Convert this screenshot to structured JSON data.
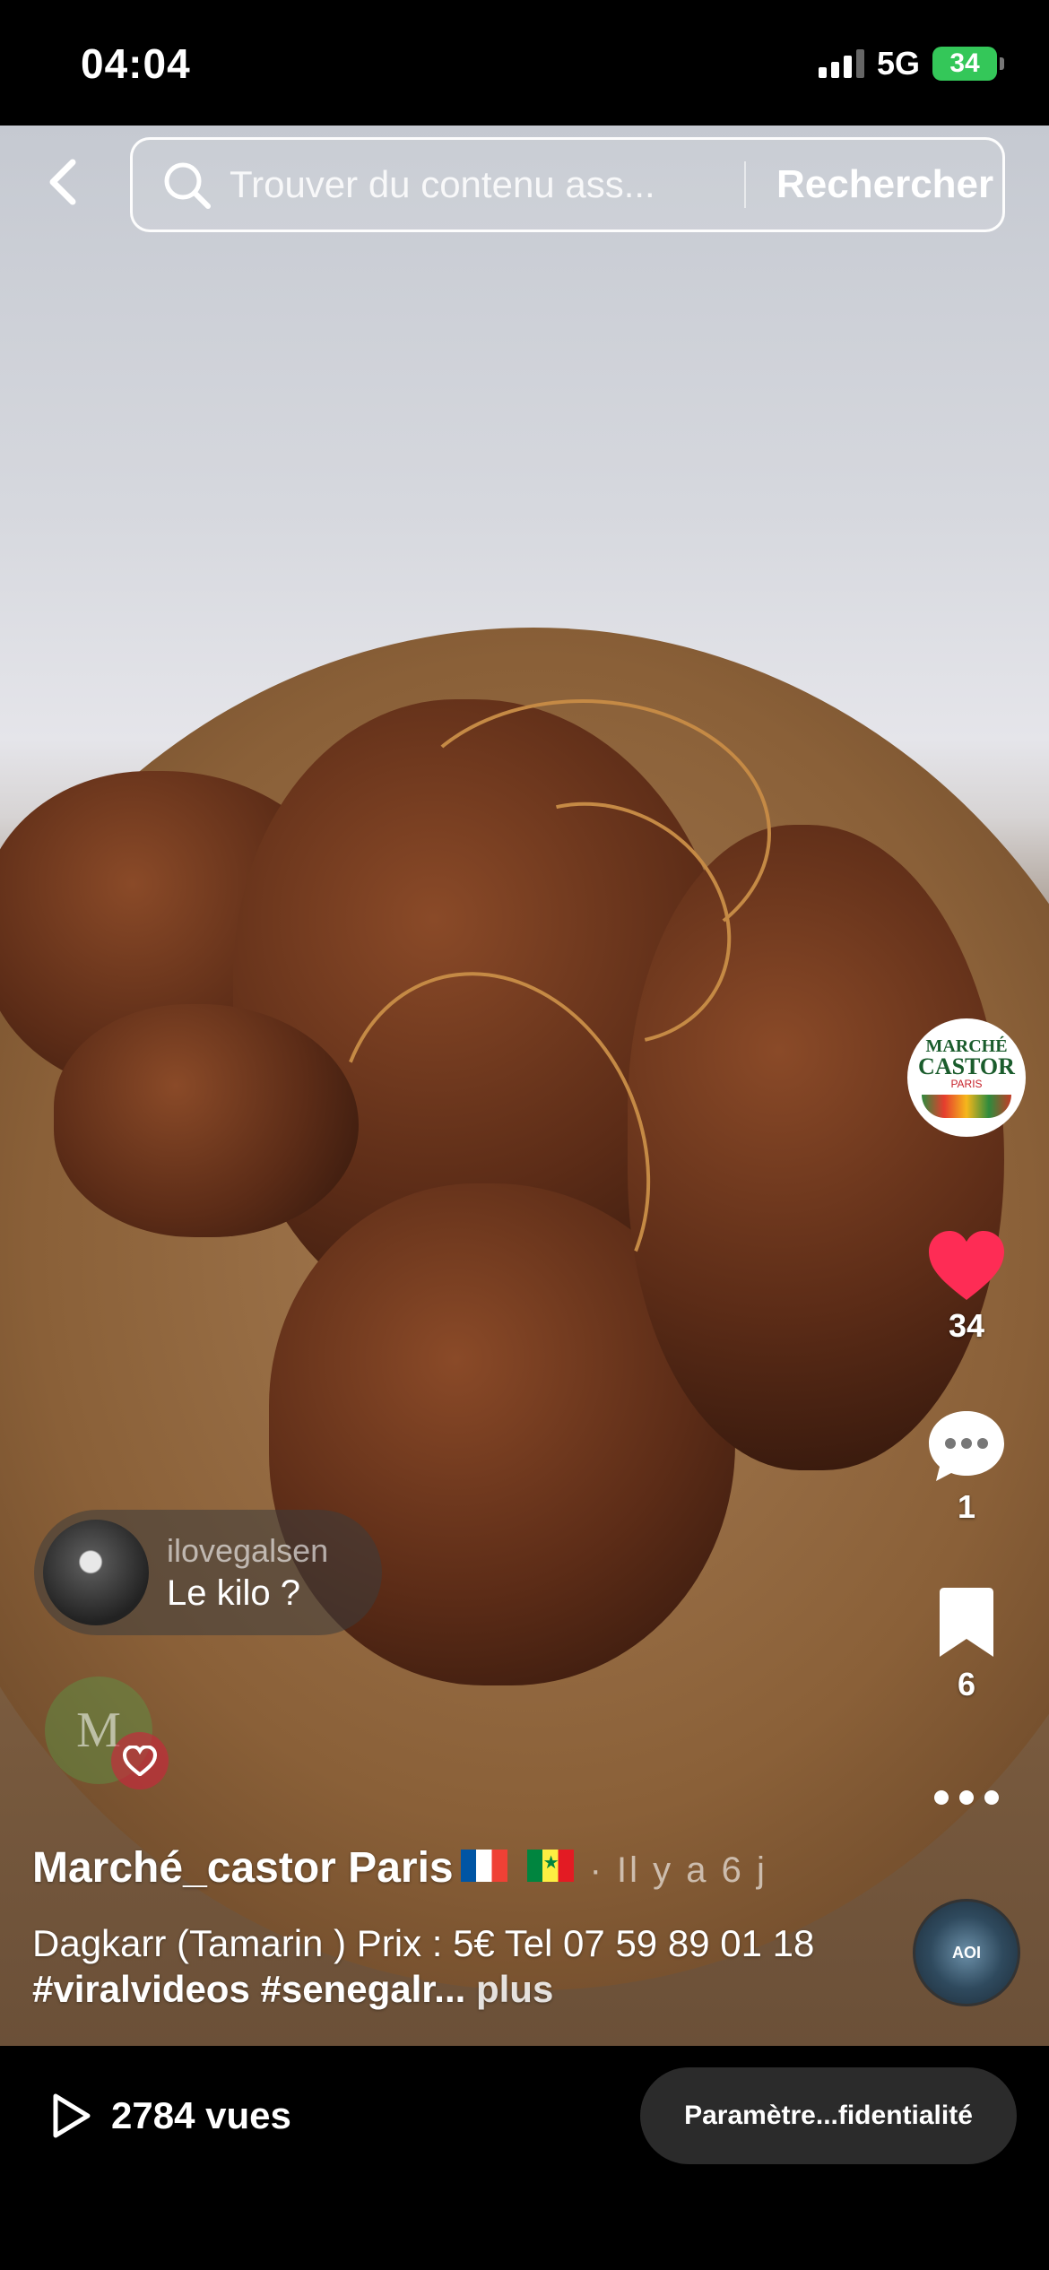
{
  "status_bar": {
    "time": "04:04",
    "network": "5G",
    "battery": "34"
  },
  "search": {
    "placeholder": "Trouver du contenu ass...",
    "submit_label": "Rechercher"
  },
  "profile": {
    "logo_top": "MARCHÉ",
    "logo_name": "CASTOR",
    "logo_city": "PARIS"
  },
  "actions": {
    "likes": "34",
    "comments": "1",
    "saves": "6"
  },
  "floating_comment": {
    "username": "ilovegalsen",
    "text": "Le kilo ?",
    "faded_initial": "M"
  },
  "post": {
    "author": "Marché_castor Paris",
    "time": "· Il y a 6 j",
    "caption_text": "Dagkarr (Tamarin )  Prix : 5€  Tel 07 59 89 01 18 ",
    "caption_tags": "#viralvideos #senegalr...",
    "more_label": " plus"
  },
  "sound": {
    "label": "AOI"
  },
  "bottom": {
    "views": "2784 vues",
    "privacy_label": "Paramètre...fidentialité"
  },
  "colors": {
    "like_red": "#fe2c55",
    "battery_green": "#34c759"
  }
}
